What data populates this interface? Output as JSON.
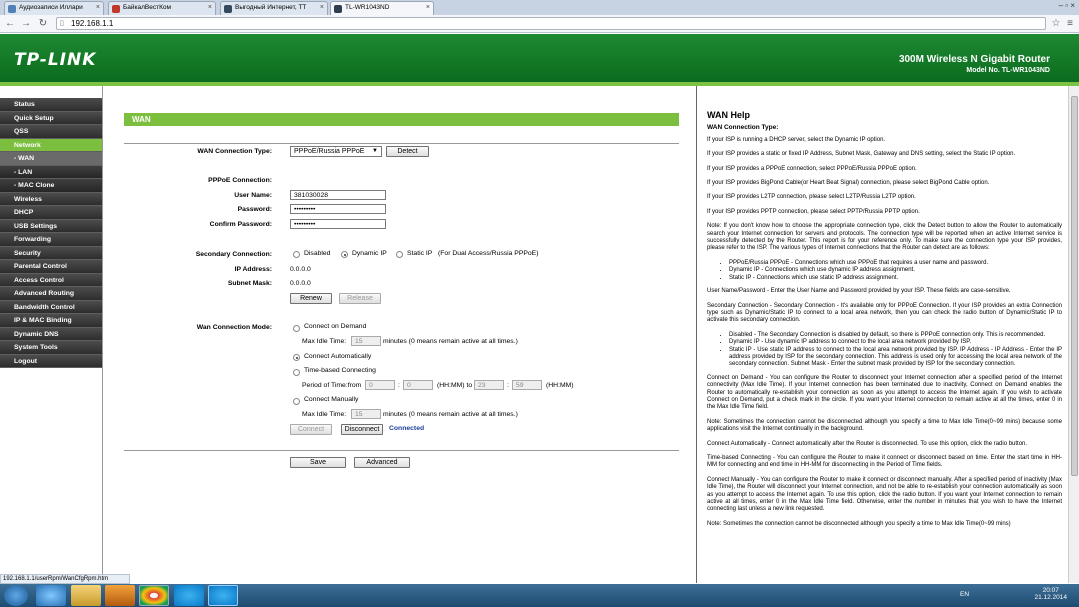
{
  "browser": {
    "tabs": [
      {
        "label": "Аудиозаписи Иллари"
      },
      {
        "label": "БайкалВестКом"
      },
      {
        "label": "Выгодный Интернет, ТТ"
      },
      {
        "label": "TL-WR1043ND"
      }
    ],
    "url": "192.168.1.1",
    "status_url": "192.168.1.1/userRpm/WanCfgRpm.htm"
  },
  "header": {
    "logo": "TP-LINK",
    "product": "300M Wireless N Gigabit Router",
    "model": "Model No. TL-WR1043ND"
  },
  "menu": {
    "items": [
      {
        "label": "Status"
      },
      {
        "label": "Quick Setup"
      },
      {
        "label": "QSS"
      },
      {
        "label": "Network"
      },
      {
        "label": "- WAN"
      },
      {
        "label": "- LAN"
      },
      {
        "label": "- MAC Clone"
      },
      {
        "label": "Wireless"
      },
      {
        "label": "DHCP"
      },
      {
        "label": "USB Settings"
      },
      {
        "label": "Forwarding"
      },
      {
        "label": "Security"
      },
      {
        "label": "Parental Control"
      },
      {
        "label": "Access Control"
      },
      {
        "label": "Advanced Routing"
      },
      {
        "label": "Bandwidth Control"
      },
      {
        "label": "IP & MAC Binding"
      },
      {
        "label": "Dynamic DNS"
      },
      {
        "label": "System Tools"
      },
      {
        "label": "Logout"
      }
    ]
  },
  "wan": {
    "title": "WAN",
    "conn_type_label": "WAN Connection Type:",
    "conn_type_value": "PPPoE/Russia PPPoE",
    "detect": "Detect",
    "pppoe_label": "PPPoE Connection:",
    "username_label": "User Name:",
    "username_value": "381030028",
    "password_label": "Password:",
    "password_value": "•••••••••",
    "confirm_label": "Confirm Password:",
    "confirm_value": "•••••••••",
    "secondary_label": "Secondary Connection:",
    "sec_disabled": "Disabled",
    "sec_dynamic": "Dynamic IP",
    "sec_static": "Static IP",
    "sec_note": "(For Dual Access/Russia PPPoE)",
    "ip_label": "IP Address:",
    "ip_value": "0.0.0.0",
    "mask_label": "Subnet Mask:",
    "mask_value": "0.0.0.0",
    "renew": "Renew",
    "release": "Release",
    "mode_label": "Wan Connection Mode:",
    "mode_demand": "Connect on Demand",
    "max_idle_label": "Max Idle Time:",
    "max_idle_value": "15",
    "max_idle_note": "minutes (0 means remain active at all times.)",
    "mode_auto": "Connect Automatically",
    "mode_time": "Time-based Connecting",
    "period_label": "Period of Time:from",
    "t1": "0",
    "t2": "0",
    "t3": "23",
    "t4": "59",
    "colon": ":",
    "hhmm_to": "(HH:MM) to",
    "hhmm": "(HH:MM)",
    "mode_manual": "Connect Manually",
    "max_idle2_value": "15",
    "connect": "Connect",
    "disconnect": "Disconnect",
    "status": "Connected",
    "save": "Save",
    "advanced": "Advanced"
  },
  "help": {
    "title": "WAN Help",
    "sub": "WAN Connection Type:",
    "p1": "If your ISP is running a DHCP server, select the Dynamic IP option.",
    "p2": "If your ISP provides a static or fixed IP Address, Subnet Mask, Gateway and DNS setting, select the Static IP option.",
    "p3": "If your ISP provides a PPPoE connection, select PPPoE/Russia PPPoE option.",
    "p4": "If your ISP provides BigPond Cable(or Heart Beat Signal) connection, please select BigPond Cable option.",
    "p5": "If your ISP provides L2TP connection, please select L2TP/Russia L2TP option.",
    "p6": "If your ISP provides PPTP connection, please select PPTP/Russia PPTP option.",
    "p7": "Note: If you don't know how to choose the appropriate connection type, click the Detect button to allow the Router to automatically search your Internet connection for servers and protocols. The connection type will be reported when an active Internet service is successfully detected by the Router. This report is for your reference only. To make sure the connection type your ISP provides, please refer to the ISP. The various types of Internet connections that the Router can detect are as follows:",
    "l1": "PPPoE/Russia PPPoE - Connections which use PPPoE that requires a user name and password.",
    "l2": "Dynamic IP - Connections which use dynamic IP address assignment.",
    "l3": "Static IP - Connections which use static IP address assignment.",
    "p8": "User Name/Password - Enter the User Name and Password provided by your ISP. These fields are case-sensitive.",
    "p9": "Secondary Connection - Secondary Connection - It's available only for PPPoE Connection. If your ISP provides an extra Connection type such as Dynamic/Static IP to connect to a local area network, then you can check the radio button of Dynamic/Static IP to activate this secondary connection.",
    "l4": "Disabled - The Secondary Connection is disabled by default, so there is PPPoE connection only. This is recommended.",
    "l5": "Dynamic IP - Use dynamic IP address to connect to the local area network provided by ISP.",
    "l6": "Static IP - Use static IP address to connect to the local area network provided by ISP. IP Address - IP Address - Enter the IP address provided by ISP for the secondary connection. This address is used only for accessing the local area network of the secondary connection. Subnet Mask - Enter the subnet mask provided by ISP for the secondary connection.",
    "p10": "Connect on Demand - You can configure the Router to disconnect your Internet connection after a specified period of the Internet connectivity (Max Idle Time). If your Internet connection has been terminated due to inactivity, Connect on Demand enables the Router to automatically re-establish your connection as soon as you attempt to access the Internet again. If you wish to activate Connect on Demand, put a check mark in the circle. If you want your Internet connection to remain active at all the times, enter 0 in the Max Idle Time field.",
    "p11": "Note: Sometimes the connection cannot be disconnected although you specify a time to Max Idle Time(0~99 mins) because some applications visit the Internet continually in the background.",
    "p12": "Connect Automatically - Connect automatically after the Router is disconnected. To use this option, click the radio button.",
    "p13": "Time-based Connecting - You can configure the Router to make it connect or disconnect based on time. Enter the start time in HH-MM for connecting and end time in HH-MM for disconnecting in the Period of Time fields.",
    "p14": "Connect Manually - You can configure the Router to make it connect or disconnect manually. After a specified period of inactivity (Max Idle Time), the Router will disconnect your Internet connection, and not be able to re-establish your connection automatically as soon as you attempt to access the Internet again. To use this option, click the radio button. If you want your Internet connection to remain active at all times, enter 0 in the Max Idle Time field. Otherwise, enter the number in minutes that you wish to have the Internet connecting last unless a new link requested.",
    "p15": "Note: Sometimes the connection cannot be disconnected although you specify a time to Max Idle Time(0~99 mins)"
  },
  "taskbar": {
    "lang": "EN",
    "time": "20:07",
    "date": "21.12.2014"
  },
  "colors": {
    "brand_green": "#0b6b1e",
    "accent_green": "#7cbf3f",
    "connected_blue": "#1a3f9a"
  }
}
